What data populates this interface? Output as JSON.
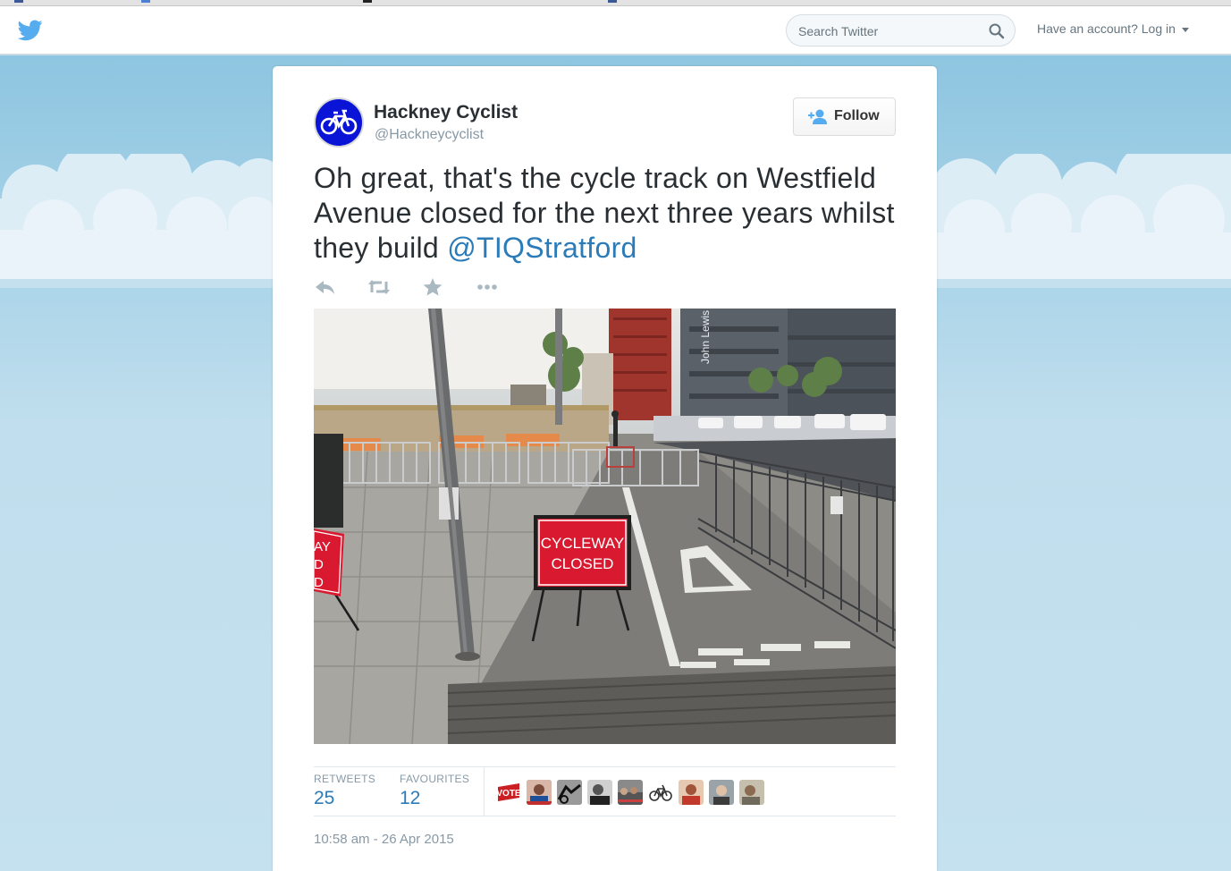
{
  "topbar": {
    "search": {
      "placeholder": "Search Twitter",
      "value": ""
    },
    "login_label": "Have an account? Log in"
  },
  "tweet": {
    "author": {
      "name": "Hackney Cyclist",
      "handle": "@Hackneycyclist"
    },
    "follow_label": "Follow",
    "text": "Oh great, that's the cycle track on Westfield Avenue closed for the next three years whilst they build ",
    "mention": "@TIQStratford",
    "photo": {
      "sign_line1": "CYCLEWAY",
      "sign_line2": "CLOSED",
      "side_sign_lines": [
        "AY",
        "D",
        "D"
      ],
      "watermark_brand": "John Lewis"
    },
    "stats": {
      "retweets_label": "RETWEETS",
      "retweets": "25",
      "favourites_label": "FAVOURITES",
      "favourites": "12"
    },
    "facepile": [
      {
        "name": "vote-badge-avatar",
        "label": "VOTE"
      },
      {
        "name": "person-avatar"
      },
      {
        "name": "bike-trick-avatar"
      },
      {
        "name": "person-avatar"
      },
      {
        "name": "crowd-avatar"
      },
      {
        "name": "bicycle-avatar"
      },
      {
        "name": "person-avatar"
      },
      {
        "name": "person-avatar"
      },
      {
        "name": "person-avatar"
      }
    ],
    "timestamp": "10:58 am - 26 Apr 2015"
  },
  "colors": {
    "twitter_blue": "#55acee",
    "link": "#2b7bb9",
    "background": "#c0deed",
    "sign_red": "#d8192f"
  },
  "icons": [
    "twitter-bird-icon",
    "search-icon",
    "caret-down-icon",
    "follow-icon",
    "reply-icon",
    "retweet-icon",
    "favorite-icon",
    "more-icon",
    "bicycle-icon"
  ]
}
